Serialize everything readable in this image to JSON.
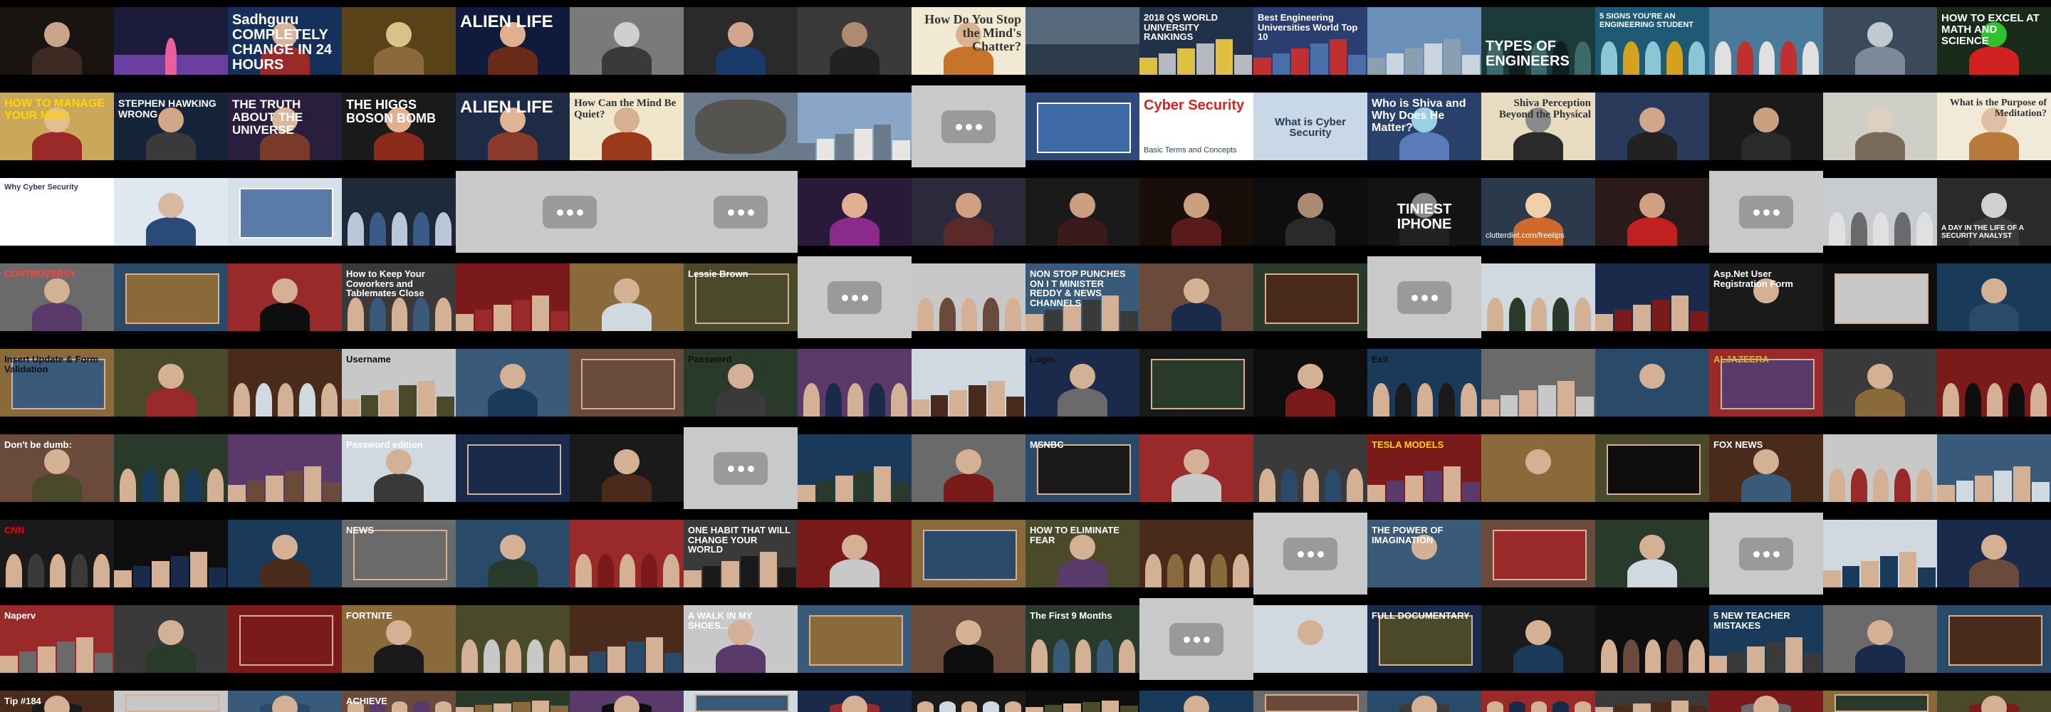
{
  "tiles": [
    {
      "bg": "#1a1410",
      "art": "figure",
      "c1": "#3d2a22",
      "c2": "#caa48a",
      "cap": "",
      "color": "#fff"
    },
    {
      "bg": "#1c1c3a",
      "art": "stage",
      "c1": "#6b3fa0",
      "c2": "#e95f9a",
      "cap": "",
      "color": "#fff"
    },
    {
      "bg": "#15305a",
      "art": "figure",
      "c1": "#9a2a2a",
      "c2": "#d9b39a",
      "cap": "Sadhguru COMPLETELY CHANGE IN 24 HOURS",
      "color": "#fff",
      "size": 20
    },
    {
      "bg": "#5a4218",
      "art": "figure",
      "c1": "#8a6a3a",
      "c2": "#d8c28a",
      "cap": "",
      "color": "#fff"
    },
    {
      "bg": "#101a3a",
      "art": "figure",
      "c1": "#6a2a1a",
      "c2": "#e0b090",
      "cap": "ALIEN LIFE",
      "color": "#fff",
      "size": 24
    },
    {
      "bg": "#7a7a7a",
      "art": "figure",
      "c1": "#3a3a3a",
      "c2": "#cfcfcf",
      "cap": "",
      "color": "#fff"
    },
    {
      "bg": "#2a2a2a",
      "art": "figure",
      "c1": "#1a3a6a",
      "c2": "#d2a68a",
      "cap": "",
      "color": "#fff"
    },
    {
      "bg": "#3a3a3a",
      "art": "figure",
      "c1": "#222",
      "c2": "#b08a70",
      "cap": "",
      "color": "#fff"
    },
    {
      "bg": "#f1e9d2",
      "art": "figure",
      "c1": "#c8732a",
      "c2": "#d9b390",
      "cap": "How Do You Stop the Mind's Chatter?",
      "color": "#333",
      "size": 18,
      "serif": true,
      "right": true
    },
    {
      "bg": "#55697a",
      "art": "sea",
      "c1": "#8ca4b8",
      "c2": "#2c3c4a",
      "cap": "",
      "color": "#fff"
    },
    {
      "bg": "#22314a",
      "art": "city",
      "c1": "#b6b9c0",
      "c2": "#e0c040",
      "cap": "2018 QS WORLD UNIVERSITY RANKINGS",
      "color": "#fff",
      "size": 13
    },
    {
      "bg": "#2a3f70",
      "art": "city",
      "c1": "#4a6fa8",
      "c2": "#c03030",
      "cap": "Best Engineering Universities World Top 10",
      "color": "#fff",
      "size": 13
    },
    {
      "bg": "#6a8fb8",
      "art": "city",
      "c1": "#c9d4dd",
      "c2": "#8aa0b0",
      "cap": "",
      "color": "#fff"
    },
    {
      "bg": "#1c3a3a",
      "art": "crowd",
      "c1": "#10201f",
      "c2": "#3a6a6a",
      "cap": "TYPES OF ENGINEERS",
      "color": "#fff",
      "size": 20,
      "bottom": true
    },
    {
      "bg": "#1e5a74",
      "art": "crowd",
      "c1": "#d6a21e",
      "c2": "#8ac6d6",
      "cap": "5 SIGNS YOU'RE AN ENGINEERING STUDENT",
      "color": "#fff",
      "size": 11
    },
    {
      "bg": "#4a7a9a",
      "art": "crowd",
      "c1": "#c03030",
      "c2": "#e0e0e0",
      "cap": "",
      "color": "#fff"
    },
    {
      "bg": "#3a4a5a",
      "art": "figure",
      "c1": "#7a8a9a",
      "c2": "#c0c8d0",
      "cap": "",
      "color": "#fff"
    },
    {
      "bg": "#1a2a1a",
      "art": "figure",
      "c1": "#d02020",
      "c2": "#30c030",
      "cap": "HOW TO EXCEL AT MATH AND SCIENCE",
      "color": "#fff",
      "size": 15
    },
    {
      "bg": "#caa85a",
      "art": "figure",
      "c1": "#9a2a2a",
      "c2": "#e0c090",
      "cap": "HOW TO MANAGE YOUR MIND",
      "color": "#ffd400",
      "size": 16
    },
    {
      "bg": "#16243a",
      "art": "figure",
      "c1": "#3a3a3a",
      "c2": "#d0a888",
      "cap": "STEPHEN HAWKING WRONG",
      "color": "#fff",
      "size": 14
    },
    {
      "bg": "#2a1e3e",
      "art": "figure",
      "c1": "#7a3a2a",
      "c2": "#dcb89a",
      "cap": "THE TRUTH ABOUT THE UNIVERSE",
      "color": "#fff",
      "size": 17
    },
    {
      "bg": "#1a1a1a",
      "art": "figure",
      "c1": "#8a2a1a",
      "c2": "#e0b090",
      "cap": "THE HIGGS BOSON BOMB",
      "color": "#fff",
      "size": 18
    },
    {
      "bg": "#1d2c44",
      "art": "figure",
      "c1": "#8a3a2a",
      "c2": "#e0b494",
      "cap": "ALIEN LIFE",
      "color": "#fff",
      "size": 24
    },
    {
      "bg": "#f0e6cc",
      "art": "figure",
      "c1": "#9a3a1a",
      "c2": "#d8b090",
      "cap": "How Can the Mind Be Quiet?",
      "color": "#333",
      "size": 15,
      "serif": true
    },
    {
      "bg": "#6a7a8a",
      "art": "tree",
      "c1": "#4a3a2a",
      "c2": "#b0b8c0",
      "cap": "",
      "color": "#fff"
    },
    {
      "bg": "#8aa6c6",
      "art": "city",
      "c1": "#e8e6e0",
      "c2": "#6a7a8a",
      "cap": "",
      "color": "#fff"
    },
    {
      "ph": true
    },
    {
      "bg": "#2e4a7a",
      "art": "slide",
      "c1": "#3e6aa8",
      "c2": "#ffffff",
      "cap": "",
      "color": "#fff"
    },
    {
      "bg": "#ffffff",
      "art": "none",
      "c1": "#fff",
      "c2": "#fff",
      "cap": "Cyber Security",
      "sub": "Basic Terms and Concepts",
      "color": "#d22",
      "size": 20,
      "subcolor": "#246"
    },
    {
      "bg": "#c9d8e6",
      "art": "none",
      "c1": "#fff",
      "c2": "#fff",
      "cap": "What is Cyber Security",
      "color": "#2a3a5a",
      "size": 15,
      "center": true
    },
    {
      "bg": "#28406a",
      "art": "figure",
      "c1": "#5a7ab8",
      "c2": "#9ad0e6",
      "cap": "Who is Shiva and Why Does He Matter?",
      "color": "#fff",
      "size": 16
    },
    {
      "bg": "#e8dcc0",
      "art": "figure",
      "c1": "#2a2a2a",
      "c2": "#8a8a8a",
      "cap": "Shiva Perception Beyond the Physical",
      "color": "#333",
      "size": 15,
      "serif": true,
      "right": true
    },
    {
      "bg": "#2a3a5a",
      "art": "figure",
      "c1": "#222",
      "c2": "#d2a68a",
      "cap": "",
      "color": "#fff"
    },
    {
      "bg": "#1a1a1a",
      "art": "figure",
      "c1": "#2a2a2a",
      "c2": "#caa080",
      "cap": "",
      "color": "#fff"
    },
    {
      "bg": "#cfcfc8",
      "art": "figure",
      "c1": "#7a6a5a",
      "c2": "#e0d0c0",
      "cap": "",
      "color": "#fff"
    },
    {
      "bg": "#f2ead8",
      "art": "figure",
      "c1": "#b87a3a",
      "c2": "#e0c0a0",
      "cap": "What is the Purpose of Meditation?",
      "color": "#333",
      "size": 14,
      "serif": true,
      "right": true
    },
    {
      "bg": "#ffffff",
      "art": "none",
      "c1": "#fff",
      "c2": "#fff",
      "cap": "Why Cyber Security",
      "color": "#2a3a5a",
      "size": 11
    },
    {
      "bg": "#dfe8f0",
      "art": "figure",
      "c1": "#2a4a7a",
      "c2": "#d8b8a0",
      "cap": "",
      "color": "#fff"
    },
    {
      "bg": "#d6e0ea",
      "art": "slide",
      "c1": "#5a7aa8",
      "c2": "#fff",
      "cap": "",
      "color": "#fff"
    },
    {
      "bg": "#1e2a3a",
      "art": "crowd",
      "c1": "#3a5a8a",
      "c2": "#b8c8d8",
      "cap": "",
      "color": "#fff"
    },
    {
      "ph": true,
      "w2": true
    },
    {
      "ph": true
    },
    {
      "bg": "#2a1a3a",
      "art": "figure",
      "c1": "#8a2a8a",
      "c2": "#e0b090",
      "cap": "",
      "color": "#ffd400",
      "size": 14
    },
    {
      "bg": "#2a2a3a",
      "art": "figure",
      "c1": "#5a2a2a",
      "c2": "#d0a080",
      "cap": "",
      "color": "#fff"
    },
    {
      "bg": "#1a1a1a",
      "art": "figure",
      "c1": "#3a1a1a",
      "c2": "#caa080",
      "cap": "",
      "color": "#fff"
    },
    {
      "bg": "#1a0e0a",
      "art": "figure",
      "c1": "#5a1a1a",
      "c2": "#caa080",
      "cap": "",
      "color": "#fff"
    },
    {
      "bg": "#0e0e0e",
      "art": "figure",
      "c1": "#2a2a2a",
      "c2": "#aa8a70",
      "cap": "",
      "color": "#fff"
    },
    {
      "bg": "#141414",
      "art": "figure",
      "c1": "#222",
      "c2": "#888",
      "cap": "TINIEST IPHONE",
      "color": "#fff",
      "size": 20,
      "center": true
    },
    {
      "bg": "#2a3a4a",
      "art": "figure",
      "c1": "#d06a2a",
      "c2": "#f0d0a8",
      "cap": "",
      "sub": "clutterdiet.com/freetips",
      "color": "#fff",
      "subcolor": "#fff"
    },
    {
      "bg": "#2a1a1a",
      "art": "figure",
      "c1": "#c02020",
      "c2": "#d0a080",
      "cap": "",
      "color": "#fff"
    },
    {
      "ph": true
    },
    {
      "bg": "#c8ccd0",
      "art": "crowd",
      "c1": "#6a6a6a",
      "c2": "#e0e0e0",
      "cap": "",
      "color": "#fff"
    },
    {
      "bg": "#2a2a2a",
      "art": "figure",
      "c1": "#3a3a3a",
      "c2": "#d0d0d0",
      "cap": "A DAY IN THE LIFE OF A SECURITY ANALYST",
      "color": "#fff",
      "size": 10,
      "bottom": true
    },
    {
      "ph": true,
      "w2": true
    },
    {
      "ph": true
    },
    {
      "bg": "#101010",
      "art": "figure",
      "c1": "#2a2a6a",
      "c2": "#caa080",
      "cap": "",
      "color": "#ffd400",
      "size": 18
    },
    {
      "bg": "#3a2a2a",
      "art": "figure",
      "c1": "#6a2a2a",
      "c2": "#d0a888",
      "cap": "",
      "color": "#fff"
    },
    {
      "bg": "#4a3a3a",
      "art": "figure",
      "c1": "#2a2a2a",
      "c2": "#d8b098",
      "cap": "",
      "color": "#fff"
    }
  ],
  "rows_layout_note": "",
  "captions_extra": [
    {
      "text": "CONTROVERSY",
      "color": "#ff4444"
    },
    {
      "text": "How to Keep Your Coworkers and Tablemates Close",
      "color": "#fff"
    },
    {
      "text": "Lessie Brown",
      "color": "#fff"
    },
    {
      "text": "NON STOP PUNCHES ON I T MINISTER REDDY & NEWS CHANNELS",
      "color": "#fff"
    },
    {
      "text": "Asp.Net User Registration Form",
      "color": "#fff"
    },
    {
      "text": "Insert Update & Form Validation",
      "color": "#111"
    },
    {
      "text": "Username",
      "color": "#111"
    },
    {
      "text": "Password",
      "color": "#111"
    },
    {
      "text": "Login",
      "color": "#111"
    },
    {
      "text": "Exit",
      "color": "#111"
    },
    {
      "text": "ALJAZEERA",
      "color": "#e0b040"
    },
    {
      "text": "Don't be dumb:",
      "color": "#fff"
    },
    {
      "text": "Password edition",
      "color": "#fff"
    },
    {
      "text": "MSNBC",
      "color": "#fff"
    },
    {
      "text": "TESLA MODELS",
      "color": "#ffd400"
    },
    {
      "text": "FOX NEWS",
      "color": "#fff"
    },
    {
      "text": "CNN",
      "color": "#e00"
    },
    {
      "text": "NEWS",
      "color": "#fff"
    },
    {
      "text": "ONE HABIT THAT WILL CHANGE YOUR WORLD",
      "color": "#fff"
    },
    {
      "text": "HOW TO ELIMINATE FEAR",
      "color": "#fff"
    },
    {
      "text": "THE POWER OF IMAGINATION",
      "color": "#fff"
    },
    {
      "text": "Naperv",
      "color": "#fff"
    },
    {
      "text": "FORTNITE",
      "color": "#fff"
    },
    {
      "text": "A WALK IN MY SHOES...",
      "color": "#fff"
    },
    {
      "text": "The First 9 Months",
      "color": "#fff"
    },
    {
      "text": "FULL DOCUMENTARY",
      "color": "#fff"
    },
    {
      "text": "5 NEW TEACHER MISTAKES",
      "color": "#fff"
    },
    {
      "text": "Tip #184",
      "color": "#fff"
    },
    {
      "text": "ACHIEVE",
      "color": "#fff"
    }
  ]
}
